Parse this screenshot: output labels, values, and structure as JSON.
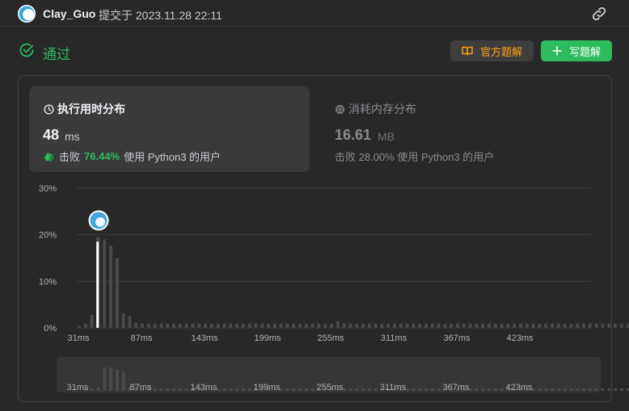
{
  "header": {
    "username": "Clay_Guo",
    "submitted_text": "提交于 2023.11.28 22:11",
    "avatar_icon": "user-avatar",
    "link_icon": "link-icon"
  },
  "status": {
    "label": "通过",
    "icon": "check-circle-icon",
    "color": "#2cbb5d"
  },
  "buttons": {
    "official_label": "官方题解",
    "official_icon": "book-icon",
    "write_label": "写题解",
    "write_icon": "plus-icon"
  },
  "runtime": {
    "title": "执行用时分布",
    "value": "48",
    "unit": "ms",
    "beats_label": "击败",
    "beats_pct": "76.44%",
    "beats_suffix": "使用 Python3 的用户",
    "icon": "clock-icon"
  },
  "memory": {
    "title": "消耗内存分布",
    "value": "16.61",
    "unit": "MB",
    "beats_label": "击败",
    "beats_pct": "28.00%",
    "beats_suffix": "使用 Python3 的用户",
    "icon": "chip-icon"
  },
  "chart_data": {
    "type": "bar",
    "ylim": [
      0,
      30
    ],
    "yticks": [
      "0%",
      "10%",
      "20%",
      "30%"
    ],
    "ytick_values": [
      0,
      10,
      20,
      30
    ],
    "xtick_labels": [
      "31ms",
      "87ms",
      "143ms",
      "199ms",
      "255ms",
      "311ms",
      "367ms",
      "423ms"
    ],
    "xtick_values": [
      31,
      87,
      143,
      199,
      255,
      311,
      367,
      423
    ],
    "bin_width_ms": 5.6,
    "x_start_ms": 31,
    "bins": 90,
    "values": [
      0.4,
      0.9,
      2.8,
      19.5,
      19.0,
      17.6,
      15.0,
      3.1,
      2.6,
      1.1,
      0.9,
      0.9,
      0.9,
      0.9,
      0.9,
      0.9,
      0.9,
      0.9,
      0.9,
      0.9,
      0.9,
      0.9,
      0.9,
      0.9,
      0.9,
      0.9,
      0.9,
      0.9,
      0.9,
      0.9,
      0.9,
      0.9,
      0.9,
      0.9,
      0.9,
      0.9,
      0.9,
      0.9,
      0.9,
      0.9,
      0.9,
      1.4,
      0.9,
      0.9,
      0.9,
      0.9,
      0.9,
      0.9,
      0.9,
      0.9,
      0.9,
      0.9,
      0.9,
      0.9,
      0.9,
      0.9,
      0.9,
      0.9,
      0.9,
      0.9,
      0.9,
      0.9,
      0.9,
      0.9,
      0.9,
      0.9,
      0.9,
      0.9,
      0.9,
      0.9,
      0.9,
      0.9,
      0.9,
      0.9,
      0.9,
      0.9,
      0.9,
      0.9,
      0.9,
      0.9,
      0.9,
      0.9,
      0.9,
      0.9,
      0.9,
      0.9,
      0.9,
      0.9,
      0.9,
      0.9
    ],
    "highlight_ms": 48,
    "highlight_value": 18.5,
    "grid": true,
    "colors": {
      "bar": "#4a4a4a",
      "highlight": "#ffffff",
      "grid": "#3e3e3e"
    }
  }
}
